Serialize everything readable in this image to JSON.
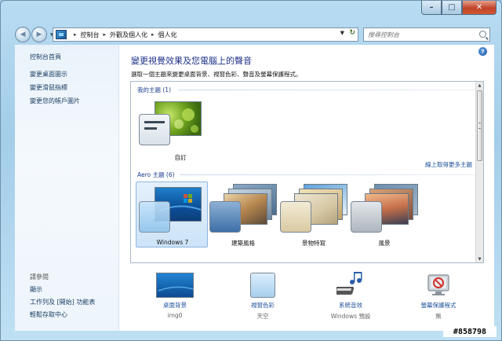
{
  "window": {
    "caption": {
      "minimize": "–",
      "maximize": "□",
      "close": "✕"
    }
  },
  "navbar": {
    "breadcrumb": [
      "控制台",
      "外觀及個人化",
      "個人化"
    ],
    "search_placeholder": "搜尋控制台"
  },
  "left_pane": {
    "home": "控制台首頁",
    "links": [
      "變更桌面圖示",
      "變更滑鼠指標",
      "變更您的帳戶圖片"
    ],
    "see_also_label": "請參閱",
    "see_also": [
      "顯示",
      "工作列及 [開始] 功能表",
      "輕鬆存取中心"
    ]
  },
  "main": {
    "title": "變更視覺效果及您電腦上的聲音",
    "description": "選取一個主題來變更桌面背景、視窗色彩、聲音及螢幕保護程式。",
    "my_themes": {
      "label": "我的主題 (1)",
      "items": [
        {
          "name": "自訂"
        }
      ]
    },
    "more_themes_link": "線上取得更多主題",
    "aero_themes": {
      "label": "Aero 主題 (6)",
      "items": [
        {
          "name": "Windows 7",
          "selected": true
        },
        {
          "name": "建築風格"
        },
        {
          "name": "景物特寫"
        },
        {
          "name": "風景"
        }
      ]
    },
    "bottom": [
      {
        "label": "桌面背景",
        "value": "img0",
        "icon": "desktop-background-icon"
      },
      {
        "label": "視窗色彩",
        "value": "天空",
        "icon": "window-color-icon"
      },
      {
        "label": "系統音效",
        "value": "Windows 預設",
        "icon": "sounds-icon"
      },
      {
        "label": "螢幕保護程式",
        "value": "無",
        "icon": "screensaver-icon"
      }
    ]
  },
  "watermark": "#858798"
}
